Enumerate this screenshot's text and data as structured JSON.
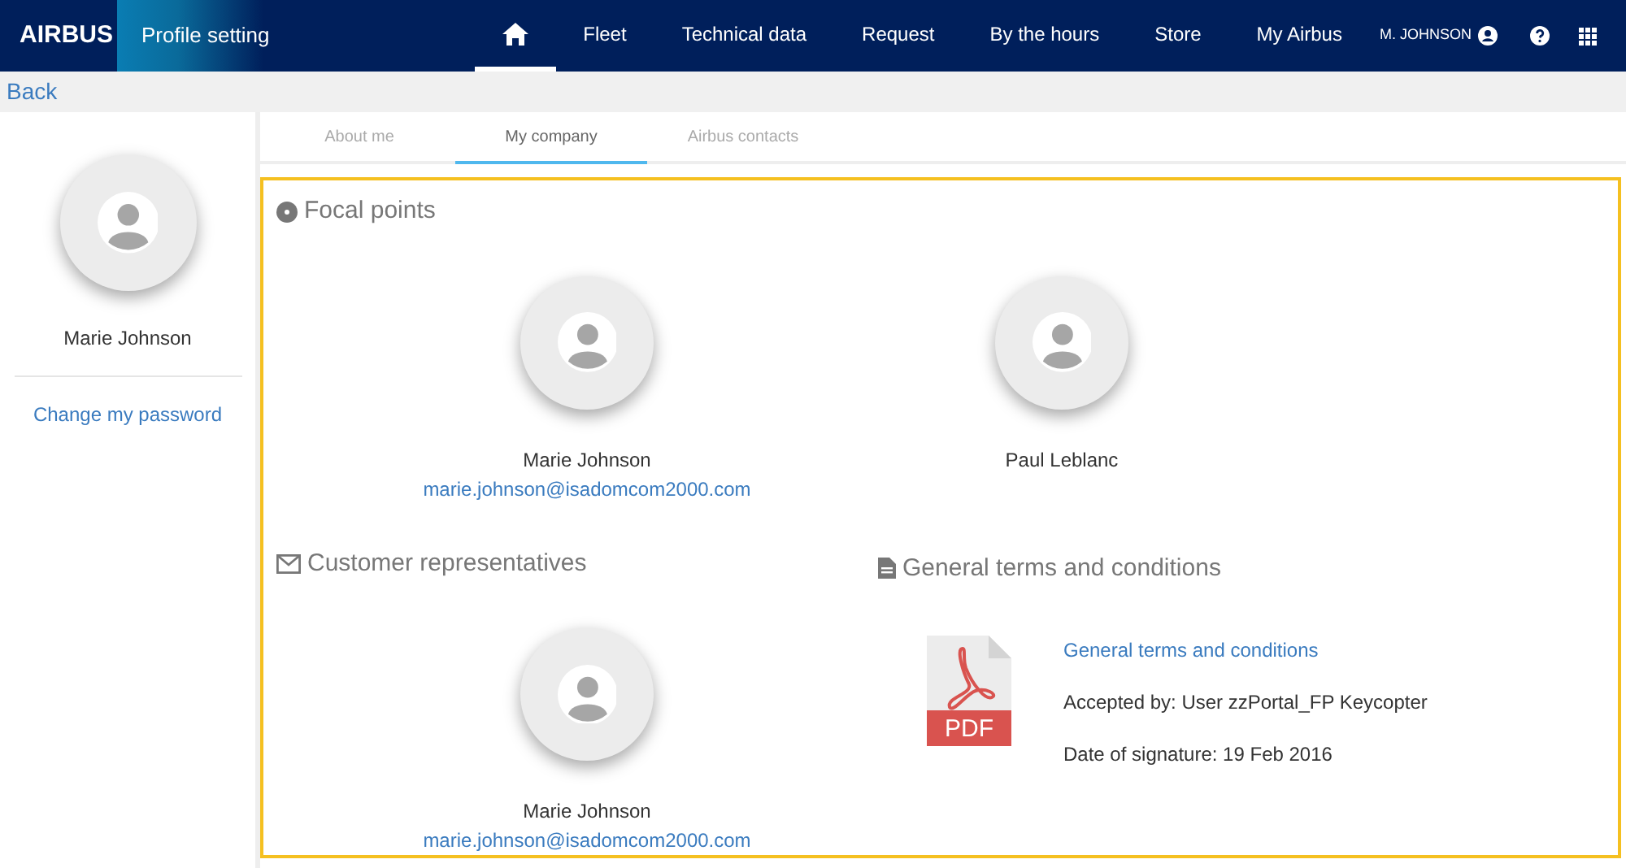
{
  "header": {
    "logo": "AIRBUS",
    "title": "Profile setting",
    "nav": [
      {
        "kind": "home",
        "selected": true
      },
      {
        "kind": "text",
        "label": "Fleet",
        "selected": false
      },
      {
        "kind": "text",
        "label": "Technical data",
        "selected": false
      },
      {
        "kind": "text",
        "label": "Request",
        "selected": false
      },
      {
        "kind": "text",
        "label": "By the hours",
        "selected": false
      },
      {
        "kind": "text",
        "label": "Store",
        "selected": false
      },
      {
        "kind": "text",
        "label": "My Airbus",
        "selected": false
      }
    ],
    "user": "M. JOHNSON"
  },
  "back": "Back",
  "sidebar": {
    "name": "Marie Johnson",
    "link": "Change my password"
  },
  "tabs": [
    {
      "label": "About me",
      "selected": false
    },
    {
      "label": "My company",
      "selected": true
    },
    {
      "label": "Airbus contacts",
      "selected": false
    }
  ],
  "focal_points": {
    "title": "Focal points",
    "people": [
      {
        "name": "Marie Johnson",
        "email": "marie.johnson@isadomcom2000.com"
      },
      {
        "name": "Paul Leblanc"
      }
    ]
  },
  "customer_representatives": {
    "title": "Customer representatives",
    "people": [
      {
        "name": "Marie Johnson",
        "email": "marie.johnson@isadomcom2000.com"
      }
    ]
  },
  "terms": {
    "title": "General terms and conditions",
    "file_type": "PDF",
    "link": "General terms and conditions",
    "accepted_by": "Accepted by: User zzPortal_FP Keycopter",
    "date": "Date of signature: 19 Feb 2016"
  }
}
